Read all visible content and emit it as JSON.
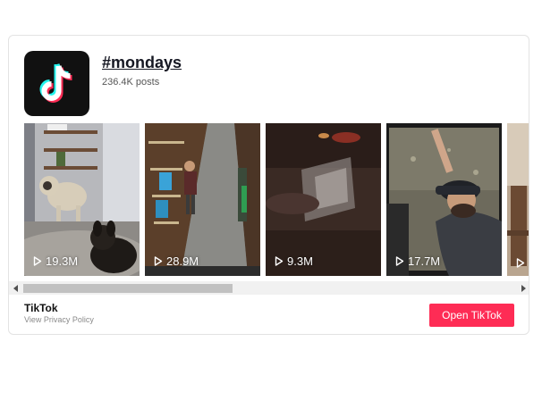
{
  "header": {
    "hashtag": "#mondays",
    "posts": "236.4K posts"
  },
  "videos": [
    {
      "views": "19.3M"
    },
    {
      "views": "28.9M"
    },
    {
      "views": "9.3M"
    },
    {
      "views": "17.7M"
    },
    {
      "views": ""
    }
  ],
  "footer": {
    "brand": "TikTok",
    "privacy": "View Privacy Policy",
    "open_button": "Open TikTok"
  },
  "colors": {
    "accent": "#fe2c55",
    "cyan": "#25f4ee"
  }
}
